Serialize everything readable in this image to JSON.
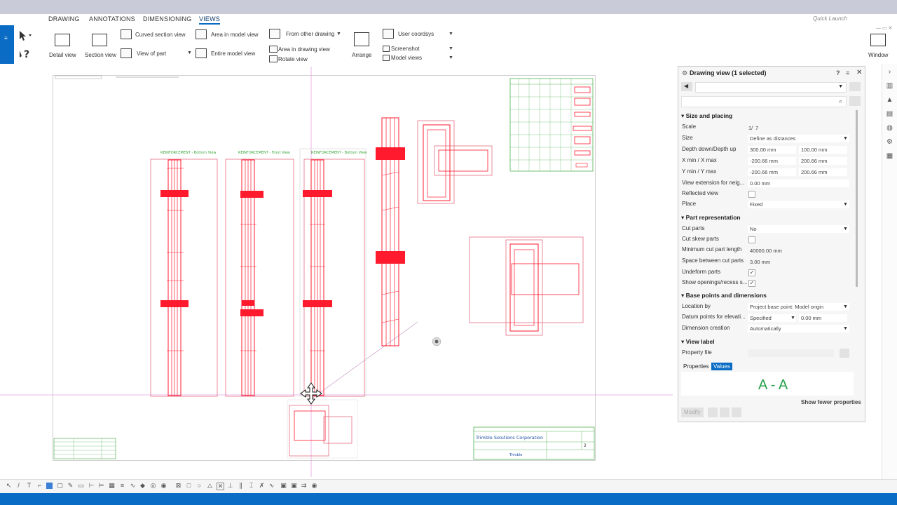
{
  "app": {
    "accent_color": "#0a6cc4",
    "quick_launch_placeholder": "Quick Launch"
  },
  "ribbon_tabs": [
    {
      "label": "DRAWING",
      "active": false
    },
    {
      "label": "ANNOTATIONS",
      "active": false
    },
    {
      "label": "DIMENSIONING",
      "active": false
    },
    {
      "label": "VIEWS",
      "active": true
    }
  ],
  "ribbon": {
    "detail_view": "Detail view",
    "section_view": "Section view",
    "curved_section_view": "Curved section view",
    "view_of_part": "View of part",
    "area_in_model_view": "Area in model view",
    "entire_model_view": "Entire model view",
    "from_other_drawing": "From other drawing",
    "area_in_drawing_view": "Area in drawing view",
    "rotate_view": "Rotate view",
    "arrange": "Arrange",
    "user_coordsys": "User coordsys",
    "screenshot": "Screenshot",
    "model_views": "Model views",
    "window": "Window"
  },
  "drawing": {
    "view_labels": [
      "REINFORCEMENT - Bottom View",
      "REINFORCEMENT - Front View",
      "REINFORCEMENT - Bottom View"
    ],
    "title_block_company": "Trimble Solutions Corporation",
    "title_block_brand": "Trimble",
    "sheet_number": "2",
    "reinforcement_color": "#ff1a2e",
    "frame_color": "#e15a6e",
    "label_color": "#3aa63a"
  },
  "panel": {
    "title": "Drawing view (1 selected)",
    "sections": {
      "size_placing": "Size and placing",
      "part_representation": "Part representation",
      "base_points": "Base points and dimensions",
      "view_label": "View label"
    },
    "props": {
      "scale_label": "Scale",
      "scale_prefix": "1/",
      "scale_value": "7",
      "size_label": "Size",
      "size_value": "Define as distances",
      "depth_label": "Depth down/Depth up",
      "depth_down": "300.00 mm",
      "depth_up": "100.00 mm",
      "xminmax_label": "X min / X max",
      "xmin": "-200.66 mm",
      "xmax": "200.66 mm",
      "yminmax_label": "Y min / Y max",
      "ymin": "-200.66 mm",
      "ymax": "200.66 mm",
      "view_ext_label": "View extension for neig...",
      "view_ext_value": "0.00 mm",
      "reflected_label": "Reflected view",
      "place_label": "Place",
      "place_value": "Fixed",
      "cut_parts_label": "Cut parts",
      "cut_parts_value": "No",
      "cut_skew_label": "Cut skew parts",
      "min_cut_label": "Minimum cut part length",
      "min_cut_value": "40000.00 mm",
      "space_cut_label": "Space between cut parts",
      "space_cut_value": "3.00 mm",
      "undeform_label": "Undeform parts",
      "show_openings_label": "Show openings/recess s...",
      "location_label": "Location by",
      "location_value": "Project base point: Model origin",
      "datum_label": "Datum points for elevati...",
      "datum_value": "Specified",
      "datum_mm": "0.00 mm",
      "dim_creation_label": "Dimension creation",
      "dim_creation_value": "Automatically",
      "property_file_label": "Property file"
    },
    "tabs": {
      "properties": "Properties",
      "values": "Values"
    },
    "label_preview": "A - A",
    "show_fewer": "Show fewer properties",
    "modify": "Modify"
  }
}
